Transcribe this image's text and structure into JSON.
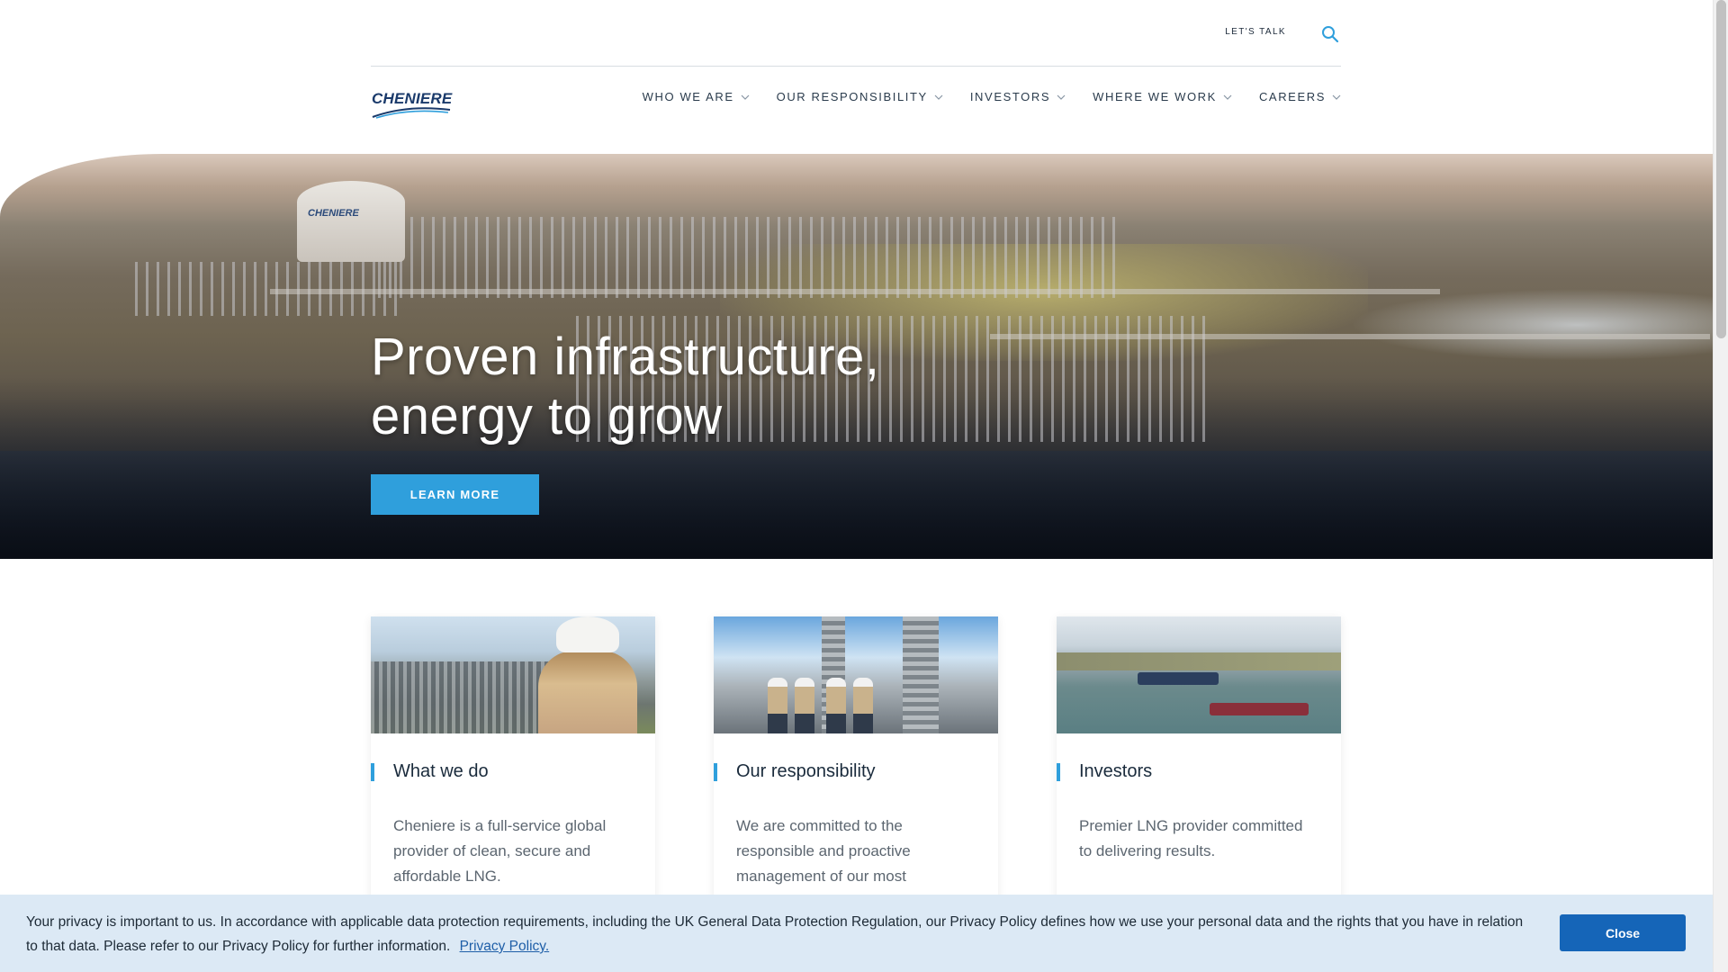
{
  "header": {
    "lets_talk": "LET'S TALK",
    "logo_text": "CHENIERE",
    "nav": [
      {
        "label": "WHO WE ARE"
      },
      {
        "label": "OUR RESPONSIBILITY"
      },
      {
        "label": "INVESTORS"
      },
      {
        "label": "WHERE WE WORK"
      },
      {
        "label": "CAREERS"
      }
    ]
  },
  "hero": {
    "title_line1": "Proven infrastructure,",
    "title_line2": "energy to grow",
    "tank_label": "CHENIERE",
    "cta": "LEARN MORE"
  },
  "cards": [
    {
      "title": "What we do",
      "text": "Cheniere is a full-service global provider of clean, secure and affordable LNG."
    },
    {
      "title": "Our responsibility",
      "text": "We are committed to the responsible and proactive management of our most"
    },
    {
      "title": "Investors",
      "text": "Premier LNG provider committed to delivering results."
    }
  ],
  "cookie": {
    "text": "Your privacy is important to us. In accordance with applicable data protection requirements, including the UK General Data Protection Regulation, our Privacy Policy defines how we use your personal data and the rights that you have in relation to that data. Please refer to our Privacy Policy for further information.",
    "link": "Privacy Policy.",
    "close": "Close"
  },
  "colors": {
    "accent": "#2f9fdc",
    "brand_navy": "#1a3a6b",
    "cookie_bg": "#dce9f5",
    "cookie_button": "#1565b8"
  },
  "icons": {
    "search": "search-icon",
    "chevron": "chevron-down-icon"
  }
}
